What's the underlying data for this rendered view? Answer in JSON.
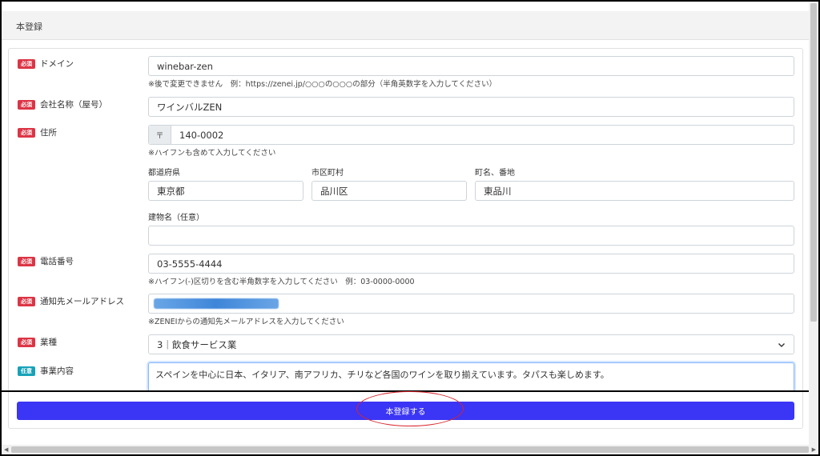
{
  "header": {
    "title": "本登録"
  },
  "badges": {
    "required": "必須",
    "optional": "任意"
  },
  "fields": {
    "domain": {
      "label": "ドメイン",
      "value": "winebar-zen",
      "hint": "※後で変更できません　例：https://zenei.jp/○○○の○○○の部分（半角英数字を入力してください）"
    },
    "company": {
      "label": "会社名称（屋号）",
      "value": "ワインバルZEN"
    },
    "address": {
      "label": "住所",
      "postal_prefix": "〒",
      "postal_value": "140-0002",
      "postal_hint": "※ハイフンも含めて入力してください",
      "prefecture_label": "都道府県",
      "prefecture_value": "東京都",
      "city_label": "市区町村",
      "city_value": "品川区",
      "town_label": "町名、番地",
      "town_value": "東品川",
      "building_label": "建物名（任意）",
      "building_value": ""
    },
    "phone": {
      "label": "電話番号",
      "value": "03-5555-4444",
      "hint": "※ハイフン(-)区切りを含む半角数字を入力してください　例：03-0000-0000"
    },
    "email": {
      "label": "通知先メールアドレス",
      "hint": "※ZENEIからの通知先メールアドレスを入力してください"
    },
    "industry": {
      "label": "業種",
      "value": "3｜飲食サービス業"
    },
    "business": {
      "label": "事業内容",
      "value": "スペインを中心に日本、イタリア、南アフリカ、チリなど各国のワインを取り揃えています。タパスも楽しめます。"
    }
  },
  "submit": {
    "label": "本登録する"
  },
  "colors": {
    "accent": "#3b35f5",
    "required": "#dc3545",
    "optional": "#17a2b8",
    "annotation": "#d9252a"
  }
}
